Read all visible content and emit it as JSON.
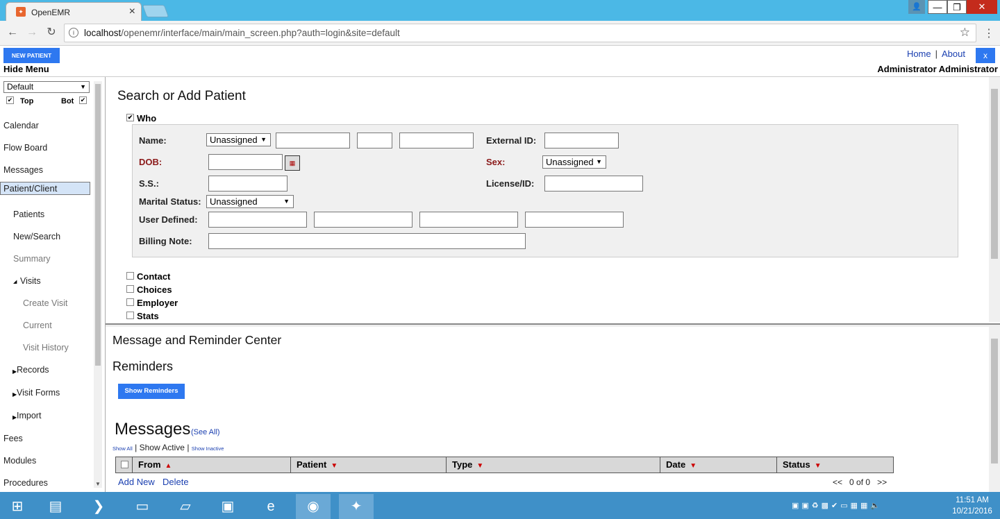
{
  "browser": {
    "tab_title": "OpenEMR",
    "tab_close": "×",
    "url_host": "localhost",
    "url_path": "/openemr/interface/main/main_screen.php?auth=login&site=default",
    "back": "←",
    "forward": "→",
    "reload": "↻",
    "info": "i",
    "star": "☆",
    "menu": "⋮",
    "win_user": "👤",
    "win_min": "—",
    "win_max": "❐",
    "win_close": "✕"
  },
  "header": {
    "new_patient": "NEW PATIENT",
    "hide_menu": "Hide Menu",
    "home": "Home",
    "sep": "|",
    "about": "About",
    "x": "x",
    "user": "Administrator Administrator"
  },
  "sidebar": {
    "select_value": "Default",
    "top_label": "Top",
    "bot_label": "Bot",
    "items": [
      {
        "label": "Calendar"
      },
      {
        "label": "Flow Board"
      },
      {
        "label": "Messages"
      },
      {
        "label": "Patient/Client"
      },
      {
        "label": "Patients"
      },
      {
        "label": "New/Search"
      },
      {
        "label": "Summary"
      },
      {
        "label": "Visits"
      },
      {
        "label": "Create Visit"
      },
      {
        "label": "Current"
      },
      {
        "label": "Visit History"
      },
      {
        "label": "Records"
      },
      {
        "label": "Visit Forms"
      },
      {
        "label": "Import"
      },
      {
        "label": "Fees"
      },
      {
        "label": "Modules"
      },
      {
        "label": "Procedures"
      }
    ]
  },
  "search": {
    "title": "Search or Add Patient",
    "who": "Who",
    "name_label": "Name:",
    "name_title_value": "Unassigned",
    "external_id_label": "External ID:",
    "dob_label": "DOB:",
    "sex_label": "Sex:",
    "sex_value": "Unassigned",
    "ss_label": "S.S.:",
    "license_label": "License/ID:",
    "marital_label": "Marital Status:",
    "marital_value": "Unassigned",
    "user_defined_label": "User Defined:",
    "billing_note_label": "Billing Note:",
    "sections": [
      "Contact",
      "Choices",
      "Employer",
      "Stats"
    ]
  },
  "messages": {
    "center_title": "Message and Reminder Center",
    "reminders_title": "Reminders",
    "show_reminders": "Show Reminders",
    "messages_title": "Messages",
    "see_all": "(See All)",
    "show_all": "Show All",
    "show_active": "Show Active",
    "show_inactive": "Show Inactive",
    "pipe": "|",
    "columns": [
      "From",
      "Patient",
      "Type",
      "Date",
      "Status"
    ],
    "add_new": "Add New",
    "delete": "Delete",
    "pager_prev": "<<",
    "pager_text": "0 of 0",
    "pager_next": ">>"
  },
  "taskbar": {
    "time": "11:51 AM",
    "date": "10/21/2016"
  }
}
